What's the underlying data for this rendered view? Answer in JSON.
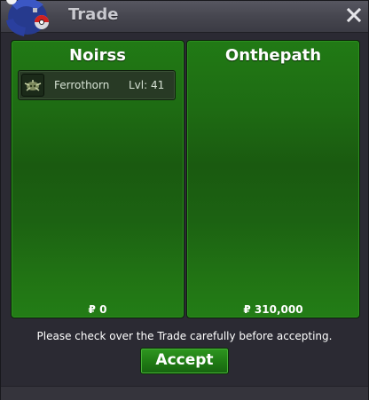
{
  "window": {
    "title": "Trade",
    "logo_icon": "pokeball-logo-icon",
    "close_icon": "close-x-icon"
  },
  "left_panel": {
    "player_name": "Noirss",
    "items": [
      {
        "icon": "ferrothorn-icon",
        "name": "Ferrothorn",
        "level": "Lvl: 41"
      }
    ],
    "money": "₽ 0"
  },
  "right_panel": {
    "player_name": "Onthepath",
    "items": [],
    "money": "₽ 310,000"
  },
  "notice": "Please check over the Trade carefully before accepting.",
  "accept_label": "Accept",
  "colors": {
    "panel_green": "#1e6b13",
    "accept_green": "#1f7a14",
    "window_bg": "#2b2a33"
  }
}
